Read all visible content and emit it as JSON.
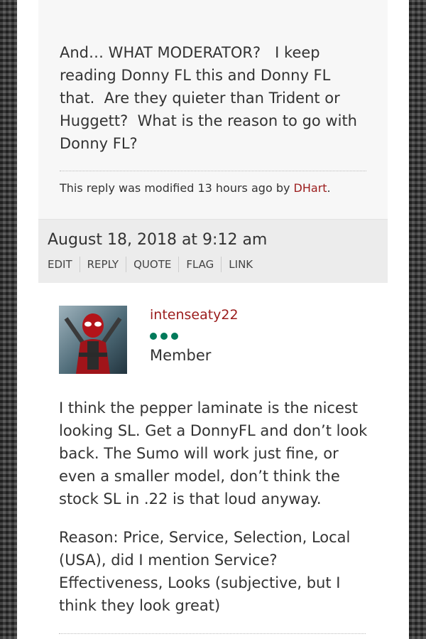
{
  "previous_post": {
    "paragraphs": [
      "And… WHAT MODERATOR?   I keep reading Donny FL this and Donny FL that.  Are they quieter than Trident or Huggett?  What is the reason to go with Donny FL?"
    ],
    "modified_prefix": "This reply was modified 13 hours ago by ",
    "modified_author": "DHart",
    "modified_suffix": "."
  },
  "reply_meta": {
    "date": "August 18, 2018 at 9:12 am",
    "actions": [
      "EDIT",
      "REPLY",
      "QUOTE",
      "FLAG",
      "LINK"
    ]
  },
  "reply": {
    "author_name": "intenseaty22",
    "author_role": "Member",
    "paragraphs": [
      "I think the pepper laminate is the nicest looking SL. Get a DonnyFL and don’t look back. The Sumo will work just fine, or even a smaller model, don’t think the stock SL in .22 is that loud anyway.",
      "Reason: Price, Service, Selection, Local (USA), did I mention Service? Effectiveness, Looks (subjective, but I think they look great)"
    ]
  },
  "colors": {
    "link": "#9b1c1c",
    "rank_dots": "#007a5a"
  }
}
